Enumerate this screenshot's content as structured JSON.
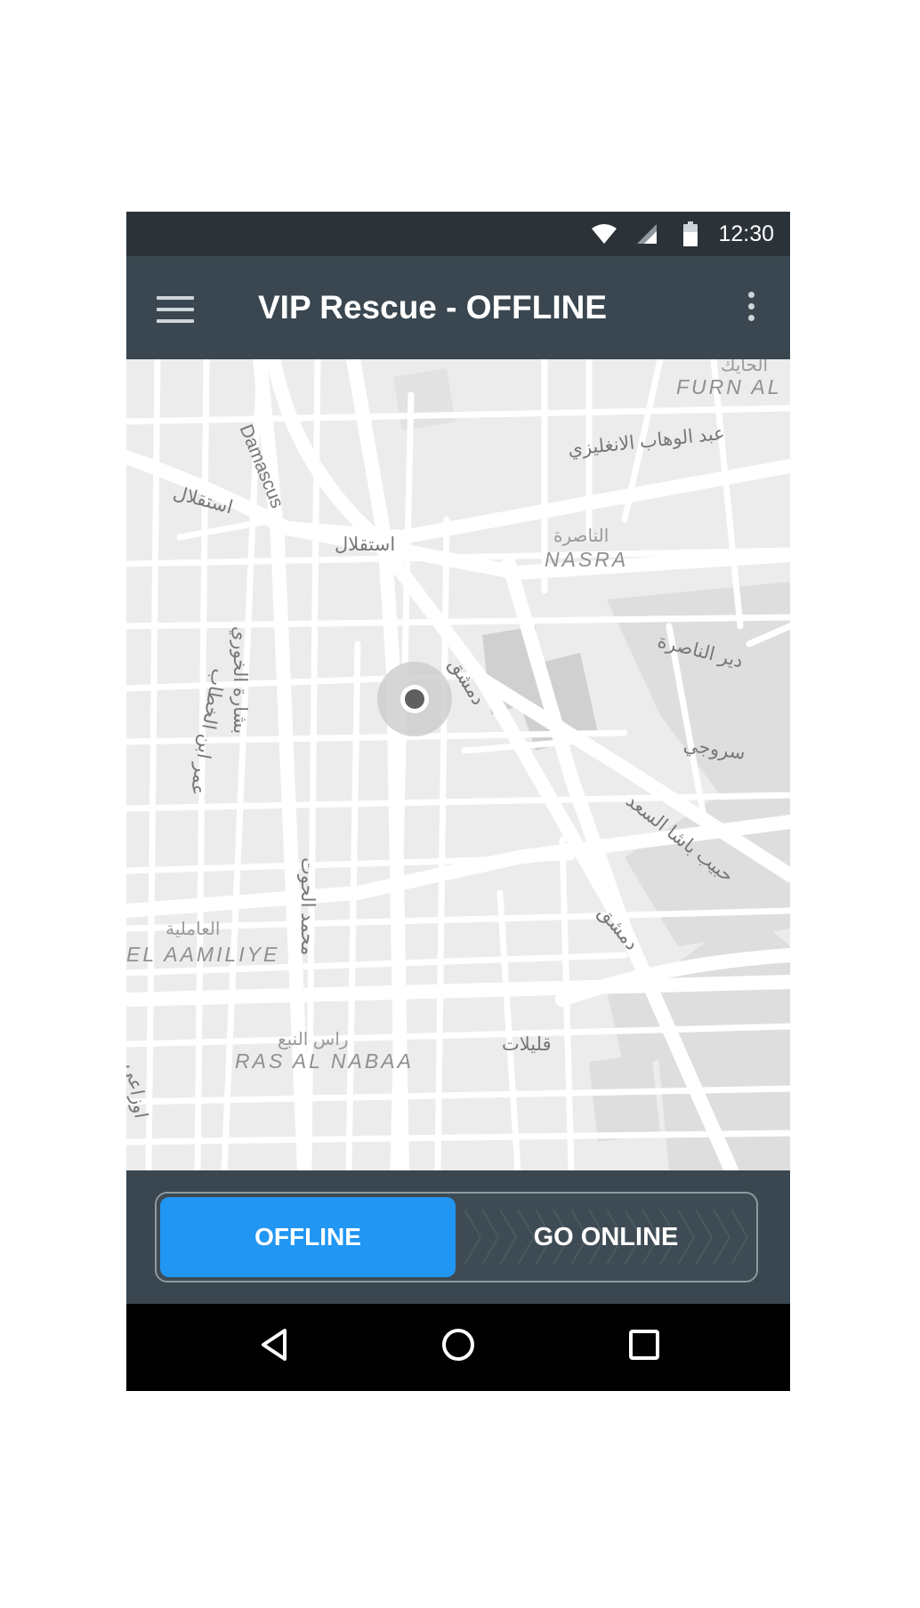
{
  "status_bar": {
    "time": "12:30",
    "icons": [
      "wifi-icon",
      "signal-icon",
      "battery-icon"
    ]
  },
  "app_bar": {
    "title": "VIP Rescue - OFFLINE",
    "menu_icon": "hamburger-icon",
    "overflow_icon": "more-vert-icon"
  },
  "map": {
    "street_labels": [
      "Damascus",
      "عبد الوهاب الانغليزي",
      "استقلال",
      "استقلال",
      "الناصرة",
      "دير الناصرة",
      "دمشق",
      "بشارة الخوري",
      "عمر ابن الخطاب",
      "سروجي",
      "حبيب باشا السعد",
      "دمشق",
      "محمد الحوت",
      "قليلات",
      "اوزاعي",
      "راس النبع",
      "العاملية",
      "الحايك"
    ],
    "area_labels": [
      "FURN AL",
      "NASRA",
      "EL AAMILIYE",
      "RAS AL NABAA"
    ],
    "location_marker": "current-location-marker"
  },
  "toggle": {
    "offline_label": "OFFLINE",
    "online_label": "GO ONLINE"
  },
  "nav_bar": {
    "icons": [
      "back-icon",
      "home-icon",
      "recents-icon"
    ]
  },
  "colors": {
    "accent": "#2196f3",
    "app_bar": "#3a4750",
    "status_bar": "#2b3339",
    "map_bg": "#ececec"
  }
}
